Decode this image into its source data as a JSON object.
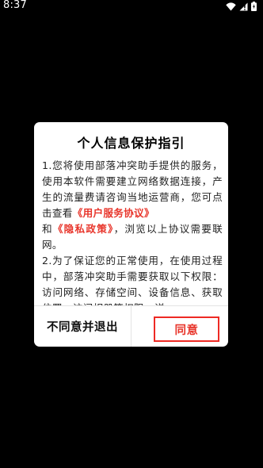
{
  "status_bar": {
    "time": "8:37"
  },
  "dialog": {
    "title": "个人信息保护指引",
    "body": {
      "p1_a": "1.您将使用部落冲突助手提供的服务，使用本软件需要建立网络数据连接，产生的流量费请咨询当地运营商，您可点击查看",
      "link_user_agreement": "《用户服务协议》",
      "p1_and": "和",
      "link_privacy_policy": "《隐私政策》",
      "p1_b": "，浏览以上协议需要联网。",
      "p2": "2.为了保证您的正常使用，在使用过程中，部落冲突助手需要获取以下权限：访问网络、存储空间、设备信息、获取位置、访问相册等权限。详"
    },
    "decline_label": "不同意并退出",
    "agree_label": "同意"
  },
  "colors": {
    "accent_red": "#e8352b",
    "highlight_border": "#ee2a24",
    "background": "#000000",
    "dialog_bg": "#ffffff"
  }
}
